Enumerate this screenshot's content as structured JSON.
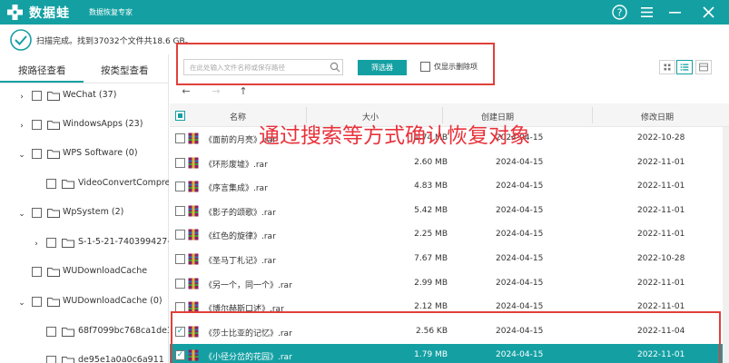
{
  "app": {
    "logo_text": "数据蛙",
    "subtitle": "数据恢复专家"
  },
  "colors": {
    "accent": "#14a0a3",
    "highlight": "#e0403a",
    "overlay_text": "#e8323b"
  },
  "scan": {
    "status": "扫描完成。找到37032个文件共18.6 GB。"
  },
  "sidebar": {
    "tabs": [
      {
        "label": "按路径查看",
        "active": true
      },
      {
        "label": "按类型查看",
        "active": false
      }
    ],
    "tree": [
      {
        "label": "WeChat (37)",
        "caret": "›",
        "level": 0
      },
      {
        "label": "WindowsApps (23)",
        "caret": "›",
        "level": 0
      },
      {
        "label": "WPS Software (0)",
        "caret": "⌄",
        "level": 0
      },
      {
        "label": "VideoConvertCompress",
        "caret": "",
        "level": 1
      },
      {
        "label": "WpSystem (2)",
        "caret": "⌄",
        "level": 0
      },
      {
        "label": "S-1-5-21-740399427-3",
        "caret": "›",
        "level": 1
      },
      {
        "label": "WUDownloadCache",
        "caret": "",
        "level": 0
      },
      {
        "label": "WUDownloadCache (0)",
        "caret": "⌄",
        "level": 0
      },
      {
        "label": "68f7099bc768ca1de34",
        "caret": "",
        "level": 1
      },
      {
        "label": "de95e1a0a0c6a911",
        "caret": "",
        "level": 1
      }
    ]
  },
  "toolbar": {
    "search_placeholder": "在此处输入文件名称或保存路径",
    "filter_label": "筛选器",
    "deleted_only_label": "仅显示删除项",
    "nav_back": "←",
    "nav_forward": "→",
    "nav_up": "↑"
  },
  "table": {
    "headers": {
      "name": "名称",
      "size": "大小",
      "created": "创建日期",
      "modified": "修改日期"
    },
    "rows": [
      {
        "name": "《面前的月亮》.rar",
        "size": "1.74 MB",
        "created": "2024-04-15",
        "modified": "2022-10-28",
        "checked": false,
        "selected": false
      },
      {
        "name": "《环形废墟》.rar",
        "size": "2.60 MB",
        "created": "2024-04-15",
        "modified": "2022-11-01",
        "checked": false,
        "selected": false
      },
      {
        "name": "《序言集成》.rar",
        "size": "4.83 MB",
        "created": "2024-04-15",
        "modified": "2022-11-01",
        "checked": false,
        "selected": false
      },
      {
        "name": "《影子的颂歌》.rar",
        "size": "5.42 MB",
        "created": "2024-04-15",
        "modified": "2022-11-01",
        "checked": false,
        "selected": false
      },
      {
        "name": "《红色的旋律》.rar",
        "size": "2.25 MB",
        "created": "2024-04-15",
        "modified": "2022-11-01",
        "checked": false,
        "selected": false
      },
      {
        "name": "《圣马丁札记》.rar",
        "size": "7.67 MB",
        "created": "2024-04-15",
        "modified": "2022-10-28",
        "checked": false,
        "selected": false
      },
      {
        "name": "《另一个，同一个》.rar",
        "size": "2.99 MB",
        "created": "2024-04-15",
        "modified": "2022-11-01",
        "checked": false,
        "selected": false
      },
      {
        "name": "《博尔赫斯口述》.rar",
        "size": "2.12 MB",
        "created": "2024-04-15",
        "modified": "2022-11-01",
        "checked": false,
        "selected": false
      },
      {
        "name": "《莎士比亚的记忆》.rar",
        "size": "2.56 KB",
        "created": "2024-04-15",
        "modified": "2022-11-04",
        "checked": true,
        "selected": false
      },
      {
        "name": "《小径分岔的花园》.rar",
        "size": "1.79 MB",
        "created": "2024-04-15",
        "modified": "2022-11-01",
        "checked": true,
        "selected": true
      }
    ]
  },
  "overlay": {
    "text": "通过搜索等方式确认恢复对象"
  }
}
